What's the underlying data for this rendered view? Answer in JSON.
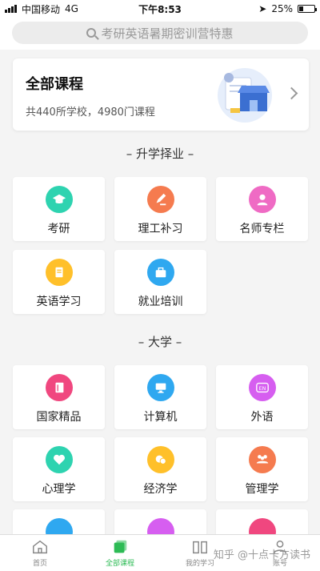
{
  "status_bar": {
    "carrier": "中国移动",
    "network": "4G",
    "time": "下午8:53",
    "battery": "25%"
  },
  "search": {
    "placeholder": "考研英语暑期密训营特惠"
  },
  "all_courses": {
    "title": "全部课程",
    "subtitle": "共440所学校，4980门课程"
  },
  "sections": [
    {
      "title": "– 升学择业 –"
    },
    {
      "title": "– 大学 –"
    }
  ],
  "categories": [
    {
      "label": "考研",
      "color": "#2ed3b0",
      "icon": "graduation-cap-icon"
    },
    {
      "label": "理工补习",
      "color": "#f57b4f",
      "icon": "pencil-icon"
    },
    {
      "label": "名师专栏",
      "color": "#ef6bc4",
      "icon": "teacher-icon"
    },
    {
      "label": "英语学习",
      "color": "#ffc02a",
      "icon": "notebook-icon"
    },
    {
      "label": "就业培训",
      "color": "#2fa8f0",
      "icon": "briefcase-icon"
    },
    {
      "label": "国家精品",
      "color": "#f0477f",
      "icon": "book-icon"
    },
    {
      "label": "计算机",
      "color": "#2fa8f0",
      "icon": "monitor-icon"
    },
    {
      "label": "外语",
      "color": "#d65ef0",
      "icon": "en-icon",
      "badge": "EN"
    },
    {
      "label": "心理学",
      "color": "#2ed3b0",
      "icon": "heart-icon"
    },
    {
      "label": "经济学",
      "color": "#ffc02a",
      "icon": "coins-icon"
    },
    {
      "label": "管理学",
      "color": "#f57b4f",
      "icon": "people-icon"
    }
  ],
  "tabbar": [
    {
      "label": "首页",
      "icon": "home-icon"
    },
    {
      "label": "全部课程",
      "icon": "courses-icon",
      "active": true
    },
    {
      "label": "我的学习",
      "icon": "study-icon"
    },
    {
      "label": "账号",
      "icon": "account-icon"
    }
  ],
  "watermark": "知乎 @十点卡方读书"
}
